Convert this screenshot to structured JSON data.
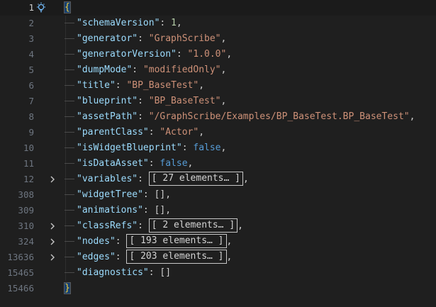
{
  "editor": {
    "lines": [
      {
        "num": "1",
        "current": true,
        "lightbulb": true,
        "fold": false,
        "indent": false,
        "tokens": [
          {
            "t": "brace-hl",
            "v": "{"
          }
        ]
      },
      {
        "num": "2",
        "fold": false,
        "indent": true,
        "tokens": [
          {
            "t": "key",
            "v": "\"schemaVersion\""
          },
          {
            "t": "punct",
            "v": ": "
          },
          {
            "t": "num",
            "v": "1"
          },
          {
            "t": "punct",
            "v": ","
          }
        ]
      },
      {
        "num": "3",
        "fold": false,
        "indent": true,
        "tokens": [
          {
            "t": "key",
            "v": "\"generator\""
          },
          {
            "t": "punct",
            "v": ": "
          },
          {
            "t": "str",
            "v": "\"GraphScribe\""
          },
          {
            "t": "punct",
            "v": ","
          }
        ]
      },
      {
        "num": "4",
        "fold": false,
        "indent": true,
        "tokens": [
          {
            "t": "key",
            "v": "\"generatorVersion\""
          },
          {
            "t": "punct",
            "v": ": "
          },
          {
            "t": "str",
            "v": "\"1.0.0\""
          },
          {
            "t": "punct",
            "v": ","
          }
        ]
      },
      {
        "num": "5",
        "fold": false,
        "indent": true,
        "tokens": [
          {
            "t": "key",
            "v": "\"dumpMode\""
          },
          {
            "t": "punct",
            "v": ": "
          },
          {
            "t": "str",
            "v": "\"modifiedOnly\""
          },
          {
            "t": "punct",
            "v": ","
          }
        ]
      },
      {
        "num": "6",
        "fold": false,
        "indent": true,
        "tokens": [
          {
            "t": "key",
            "v": "\"title\""
          },
          {
            "t": "punct",
            "v": ": "
          },
          {
            "t": "str",
            "v": "\"BP_BaseTest\""
          },
          {
            "t": "punct",
            "v": ","
          }
        ]
      },
      {
        "num": "7",
        "fold": false,
        "indent": true,
        "tokens": [
          {
            "t": "key",
            "v": "\"blueprint\""
          },
          {
            "t": "punct",
            "v": ": "
          },
          {
            "t": "str",
            "v": "\"BP_BaseTest\""
          },
          {
            "t": "punct",
            "v": ","
          }
        ]
      },
      {
        "num": "8",
        "fold": false,
        "indent": true,
        "tokens": [
          {
            "t": "key",
            "v": "\"assetPath\""
          },
          {
            "t": "punct",
            "v": ": "
          },
          {
            "t": "str",
            "v": "\"/GraphScribe/Examples/BP_BaseTest.BP_BaseTest\""
          },
          {
            "t": "punct",
            "v": ","
          }
        ]
      },
      {
        "num": "9",
        "fold": false,
        "indent": true,
        "tokens": [
          {
            "t": "key",
            "v": "\"parentClass\""
          },
          {
            "t": "punct",
            "v": ": "
          },
          {
            "t": "str",
            "v": "\"Actor\""
          },
          {
            "t": "punct",
            "v": ","
          }
        ]
      },
      {
        "num": "10",
        "fold": false,
        "indent": true,
        "tokens": [
          {
            "t": "key",
            "v": "\"isWidgetBlueprint\""
          },
          {
            "t": "punct",
            "v": ": "
          },
          {
            "t": "bool",
            "v": "false"
          },
          {
            "t": "punct",
            "v": ","
          }
        ]
      },
      {
        "num": "11",
        "fold": false,
        "indent": true,
        "tokens": [
          {
            "t": "key",
            "v": "\"isDataAsset\""
          },
          {
            "t": "punct",
            "v": ": "
          },
          {
            "t": "bool",
            "v": "false"
          },
          {
            "t": "punct",
            "v": ","
          }
        ]
      },
      {
        "num": "12",
        "fold": true,
        "indent": true,
        "tokens": [
          {
            "t": "key",
            "v": "\"variables\""
          },
          {
            "t": "punct",
            "v": ": "
          },
          {
            "t": "collapsed",
            "v": "[ 27 elements… ]"
          },
          {
            "t": "punct",
            "v": ","
          }
        ]
      },
      {
        "num": "308",
        "fold": false,
        "indent": true,
        "tokens": [
          {
            "t": "key",
            "v": "\"widgetTree\""
          },
          {
            "t": "punct",
            "v": ": [],"
          }
        ]
      },
      {
        "num": "309",
        "fold": false,
        "indent": true,
        "tokens": [
          {
            "t": "key",
            "v": "\"animations\""
          },
          {
            "t": "punct",
            "v": ": [],"
          }
        ]
      },
      {
        "num": "310",
        "fold": true,
        "indent": true,
        "tokens": [
          {
            "t": "key",
            "v": "\"classRefs\""
          },
          {
            "t": "punct",
            "v": ": "
          },
          {
            "t": "collapsed",
            "v": "[ 2 elements… ]"
          },
          {
            "t": "punct",
            "v": ","
          }
        ]
      },
      {
        "num": "324",
        "fold": true,
        "indent": true,
        "tokens": [
          {
            "t": "key",
            "v": "\"nodes\""
          },
          {
            "t": "punct",
            "v": ": "
          },
          {
            "t": "collapsed",
            "v": "[ 193 elements… ]"
          },
          {
            "t": "punct",
            "v": ","
          }
        ]
      },
      {
        "num": "13636",
        "fold": true,
        "indent": true,
        "tokens": [
          {
            "t": "key",
            "v": "\"edges\""
          },
          {
            "t": "punct",
            "v": ": "
          },
          {
            "t": "collapsed",
            "v": "[ 203 elements… ]"
          },
          {
            "t": "punct",
            "v": ","
          }
        ]
      },
      {
        "num": "15465",
        "fold": false,
        "indent": true,
        "tokens": [
          {
            "t": "key",
            "v": "\"diagnostics\""
          },
          {
            "t": "punct",
            "v": ": []"
          }
        ]
      },
      {
        "num": "15466",
        "fold": false,
        "indent": false,
        "tokens": [
          {
            "t": "brace-hl",
            "v": "}"
          }
        ]
      }
    ],
    "icons": {
      "lightbulb": "lightbulb-icon",
      "fold": "chevron-right-icon"
    },
    "colors": {
      "background": "#1f1f1f",
      "key": "#9cdcfe",
      "string": "#ce9178",
      "number": "#b5cea8",
      "boolean": "#569cd6",
      "brace": "#f2cc3a"
    }
  }
}
